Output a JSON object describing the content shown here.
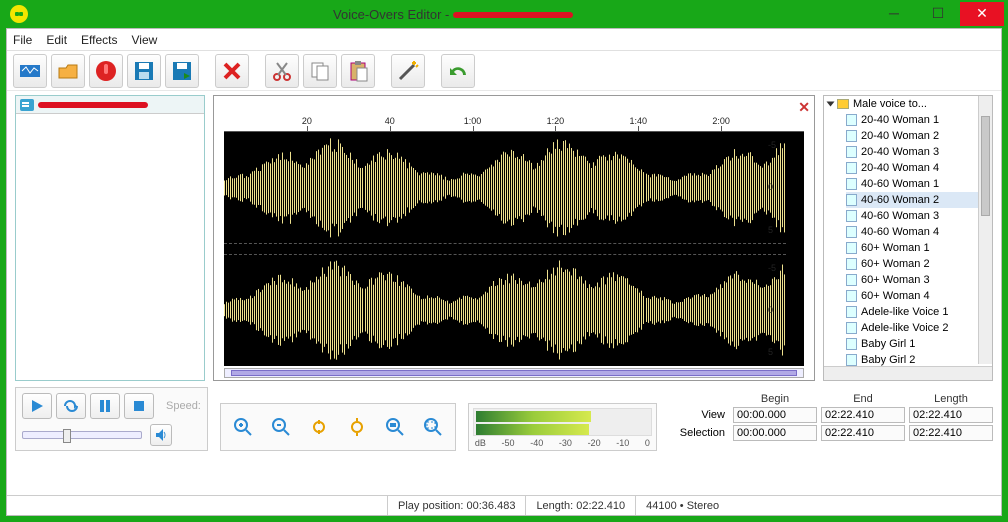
{
  "title_prefix": "Voice-Overs Editor - ",
  "menu": {
    "file": "File",
    "edit": "Edit",
    "effects": "Effects",
    "view": "View"
  },
  "ruler_labels": [
    "20",
    "40",
    "1:00",
    "1:20",
    "1:40",
    "2:00"
  ],
  "yscale": [
    "-5",
    "0",
    "5",
    "-5",
    "0",
    "5"
  ],
  "voice_tree_header": "Male voice to...",
  "voices": [
    "20-40 Woman 1",
    "20-40 Woman 2",
    "20-40 Woman 3",
    "20-40 Woman 4",
    "40-60 Woman 1",
    "40-60 Woman 2",
    "40-60 Woman 3",
    "40-60 Woman 4",
    "60+ Woman 1",
    "60+ Woman 2",
    "60+ Woman 3",
    "60+ Woman 4",
    "Adele-like Voice 1",
    "Adele-like Voice 2",
    "Baby Girl 1",
    "Baby Girl 2"
  ],
  "selected_voice_index": 5,
  "speed_label": "Speed:",
  "meter_label": "dB",
  "meter_ticks": [
    "-50",
    "-40",
    "-30",
    "-20",
    "-10",
    "0"
  ],
  "time": {
    "headers": {
      "begin": "Begin",
      "end": "End",
      "length": "Length"
    },
    "rows": {
      "view": {
        "label": "View",
        "begin": "00:00.000",
        "end": "02:22.410",
        "length": "02:22.410"
      },
      "selection": {
        "label": "Selection",
        "begin": "00:00.000",
        "end": "02:22.410",
        "length": "02:22.410"
      }
    }
  },
  "status": {
    "play_position_label": "Play position:",
    "play_position_value": "00:36.483",
    "length_label": "Length:",
    "length_value": "02:22.410",
    "sample_rate": "44100",
    "channels": "Stereo"
  }
}
